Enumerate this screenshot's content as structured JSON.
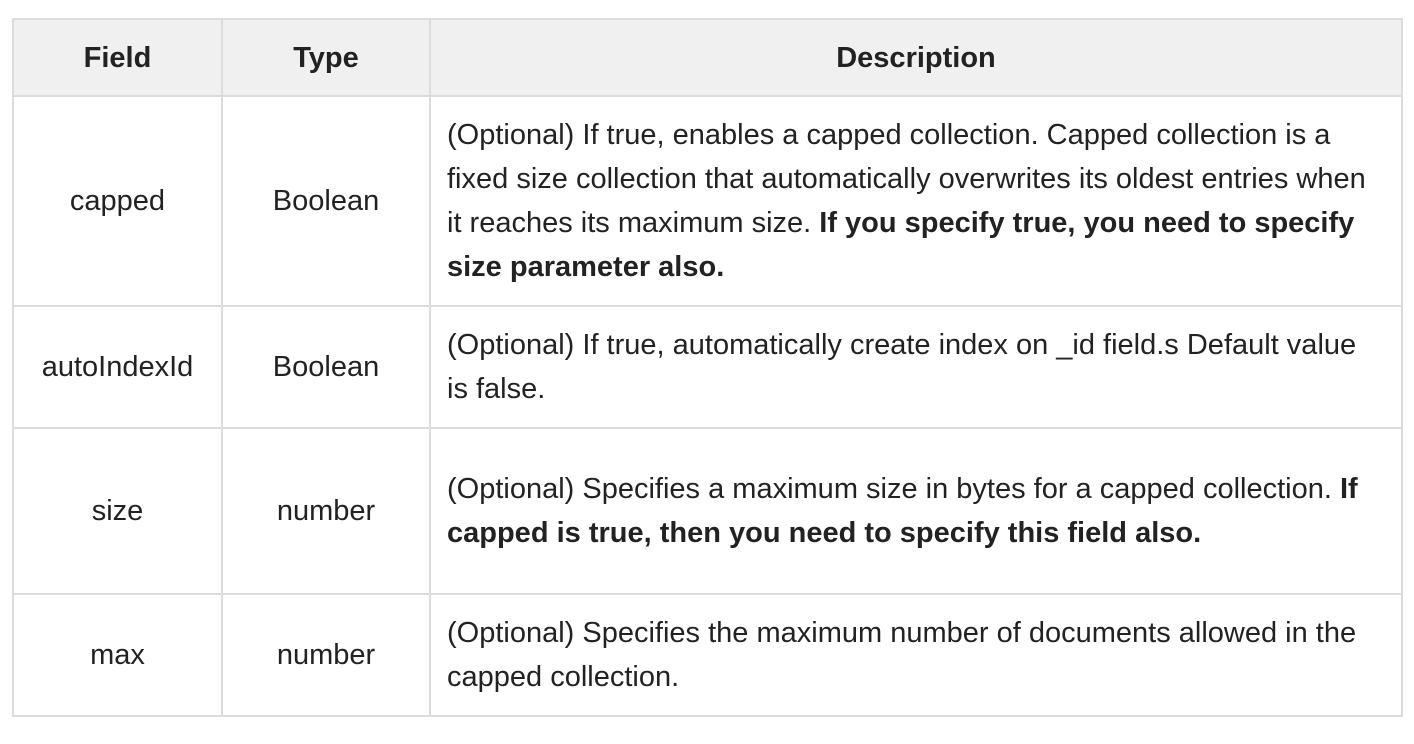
{
  "table": {
    "headers": {
      "field": "Field",
      "type": "Type",
      "description": "Description"
    },
    "rows": [
      {
        "field": "capped",
        "type": "Boolean",
        "description": "(Optional) If true, enables a capped collection. Capped collection is a fixed size collection that automatically overwrites its oldest entries when it reaches its maximum size.",
        "emphasis": "If you specify true, you need to specify size parameter also."
      },
      {
        "field": "autoIndexId",
        "type": "Boolean",
        "description": "(Optional) If true, automatically create index on _id field.s Default value is false.",
        "emphasis": ""
      },
      {
        "field": "size",
        "type": "number",
        "description": "(Optional) Specifies a maximum size in bytes for a capped collection.",
        "emphasis": "If capped is true, then you need to specify this field also."
      },
      {
        "field": "max",
        "type": "number",
        "description": "(Optional) Specifies the maximum number of documents allowed in the capped collection.",
        "emphasis": ""
      }
    ]
  }
}
